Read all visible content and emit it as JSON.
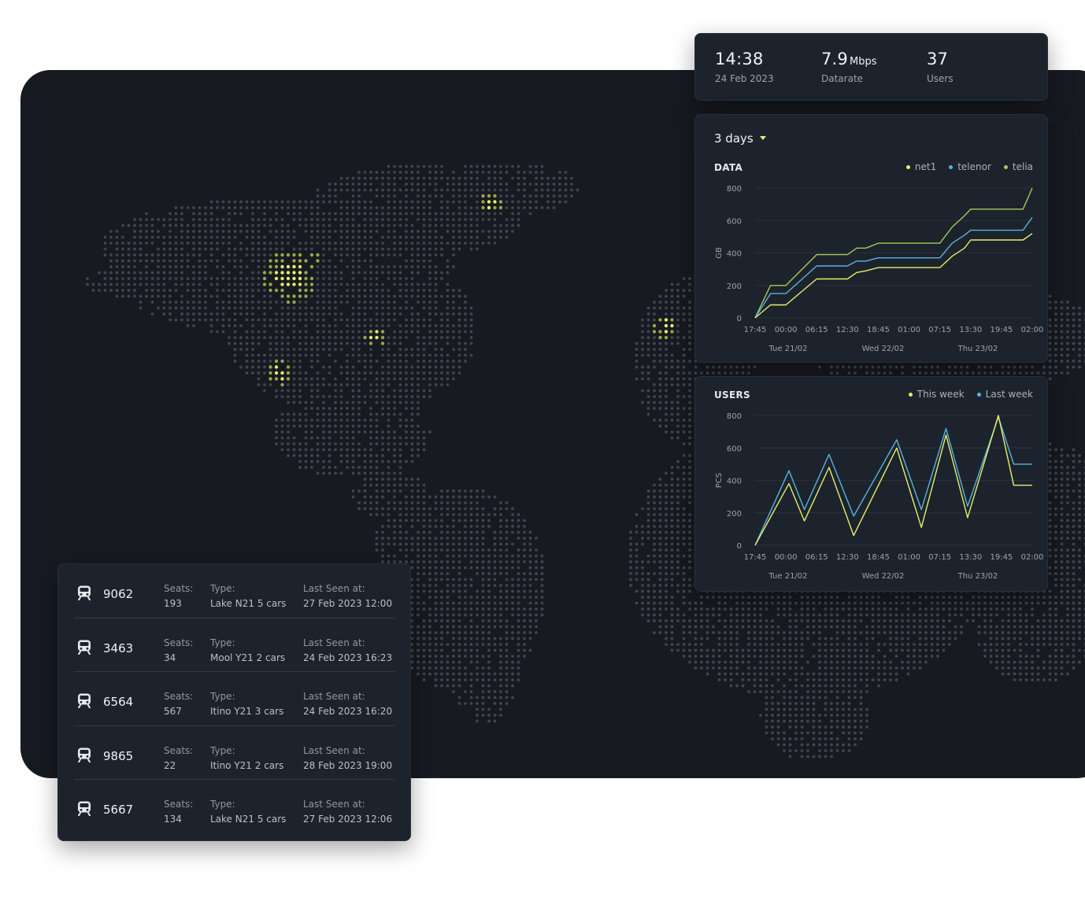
{
  "stats": [
    {
      "value": "14:38",
      "unit": "",
      "label": "24 Feb 2023"
    },
    {
      "value": "7.9",
      "unit": "Mbps",
      "label": "Datarate"
    },
    {
      "value": "37",
      "unit": "",
      "label": "Users"
    }
  ],
  "range_selector": {
    "label": "3 days"
  },
  "colors": {
    "yellow": "#e7ee6c",
    "blue": "#58b4de",
    "green": "#a5cc5a",
    "panel": "#171a21",
    "card": "#1d232c"
  },
  "chart_data": [
    {
      "type": "line",
      "title": "DATA",
      "ylabel": "GB",
      "ylim": [
        0,
        800
      ],
      "yticks": [
        0,
        200,
        400,
        600,
        800
      ],
      "xtick_labels": [
        "17:45",
        "00:00",
        "06:15",
        "12:30",
        "18:45",
        "01:00",
        "07:15",
        "13:30",
        "19:45",
        "02:00"
      ],
      "date_labels": [
        "Tue 21/02",
        "Wed 22/02",
        "Thu 23/02"
      ],
      "x": [
        0,
        0.5,
        1,
        2,
        3,
        3.3,
        3.6,
        4,
        5,
        6,
        6.4,
        6.8,
        7,
        8,
        8.7,
        9
      ],
      "series": [
        {
          "name": "net1",
          "color": "yellow",
          "values": [
            0,
            80,
            80,
            240,
            240,
            280,
            290,
            310,
            310,
            310,
            380,
            430,
            480,
            480,
            480,
            520
          ]
        },
        {
          "name": "telenor",
          "color": "blue",
          "values": [
            0,
            150,
            150,
            320,
            320,
            350,
            350,
            370,
            370,
            370,
            460,
            510,
            540,
            540,
            540,
            620
          ]
        },
        {
          "name": "telia",
          "color": "green",
          "values": [
            0,
            200,
            200,
            390,
            390,
            430,
            430,
            460,
            460,
            460,
            560,
            630,
            670,
            670,
            670,
            800
          ]
        }
      ]
    },
    {
      "type": "line",
      "title": "USERS",
      "ylabel": "PCS",
      "ylim": [
        0,
        800
      ],
      "yticks": [
        0,
        200,
        400,
        600,
        800
      ],
      "xtick_labels": [
        "17:45",
        "00:00",
        "06:15",
        "12:30",
        "18:45",
        "01:00",
        "07:15",
        "13:30",
        "19:45",
        "02:00"
      ],
      "date_labels": [
        "Tue 21/02",
        "Wed 22/02",
        "Thu 23/02"
      ],
      "x": [
        0,
        1.1,
        1.6,
        2.4,
        3.2,
        4.6,
        5.4,
        6.2,
        6.9,
        7.9,
        8.4,
        9
      ],
      "series": [
        {
          "name": "This week",
          "color": "yellow",
          "values": [
            0,
            380,
            150,
            480,
            60,
            600,
            110,
            680,
            170,
            800,
            370,
            370
          ]
        },
        {
          "name": "Last week",
          "color": "blue",
          "values": [
            0,
            460,
            220,
            560,
            180,
            650,
            220,
            720,
            240,
            790,
            500,
            500
          ]
        }
      ]
    }
  ],
  "trains": [
    {
      "id": "9062",
      "seats_label": "Seats:",
      "seats": "193",
      "type_label": "Type:",
      "type": "Lake N21 5 cars",
      "seen_label": "Last Seen at:",
      "seen": "27 Feb 2023 12:00"
    },
    {
      "id": "3463",
      "seats_label": "Seats:",
      "seats": "34",
      "type_label": "Type:",
      "type": "Mool Y21 2 cars",
      "seen_label": "Last Seen at:",
      "seen": "24 Feb 2023 16:23"
    },
    {
      "id": "6564",
      "seats_label": "Seats:",
      "seats": "567",
      "type_label": "Type:",
      "type": "Itino Y21 3 cars",
      "seen_label": "Last Seen at:",
      "seen": "24 Feb 2023 16:20"
    },
    {
      "id": "9865",
      "seats_label": "Seats:",
      "seats": "22",
      "type_label": "Type:",
      "type": "Itino Y21 2 cars",
      "seen_label": "Last Seen at:",
      "seen": "28 Feb 2023 19:00"
    },
    {
      "id": "5667",
      "seats_label": "Seats:",
      "seats": "134",
      "type_label": "Type:",
      "type": "Lake N21 5 cars",
      "seen_label": "Last Seen at:",
      "seen": "27 Feb 2023 12:06"
    }
  ],
  "icons": {
    "train": "train-icon",
    "dropdown": "chevron-down-icon",
    "map": "dot-world-map"
  }
}
